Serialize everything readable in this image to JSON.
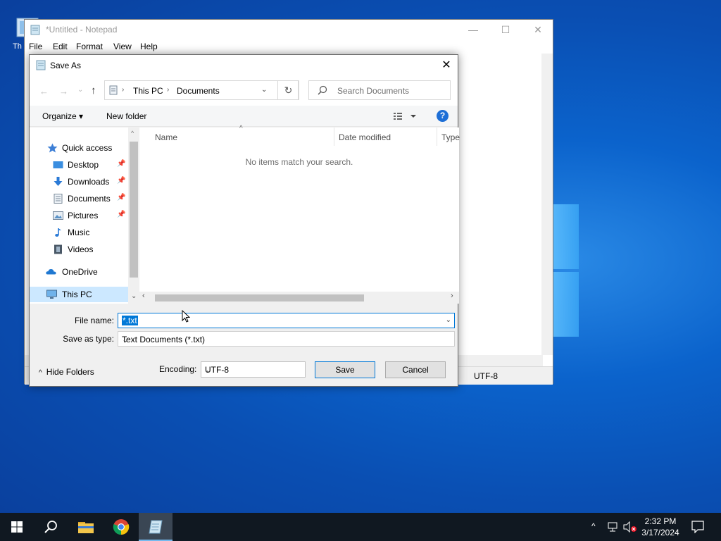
{
  "desktop": {
    "icon_label": "Th"
  },
  "notepad": {
    "title": "*Untitled - Notepad",
    "menu": [
      "File",
      "Edit",
      "Format",
      "View",
      "Help"
    ],
    "status_encoding": "UTF-8",
    "minimize": "—",
    "maximize": "☐",
    "close": "✕"
  },
  "dialog": {
    "title": "Save As",
    "close": "✕",
    "nav": {
      "back": "←",
      "forward": "→",
      "recent": "⌄",
      "up": "↑"
    },
    "breadcrumb": [
      "This PC",
      "Documents"
    ],
    "search_placeholder": "Search Documents",
    "toolbar": {
      "organize": "Organize ▾",
      "new_folder": "New folder",
      "help": "?"
    },
    "nav_items": [
      {
        "label": "Quick access",
        "icon": "star-icon"
      },
      {
        "label": "Desktop",
        "icon": "desktop-folder-icon",
        "pinned": true
      },
      {
        "label": "Downloads",
        "icon": "download-arrow-icon",
        "pinned": true
      },
      {
        "label": "Documents",
        "icon": "documents-icon",
        "pinned": true
      },
      {
        "label": "Pictures",
        "icon": "pictures-icon",
        "pinned": true
      },
      {
        "label": "Music",
        "icon": "music-note-icon"
      },
      {
        "label": "Videos",
        "icon": "film-icon"
      },
      {
        "label": "OneDrive",
        "icon": "cloud-icon"
      },
      {
        "label": "This PC",
        "icon": "computer-icon",
        "selected": true
      }
    ],
    "columns": [
      "Name",
      "Date modified",
      "Type"
    ],
    "empty_message": "No items match your search.",
    "file_name_label": "File name:",
    "file_name_value": "*.txt",
    "save_as_type_label": "Save as type:",
    "save_as_type_value": "Text Documents (*.txt)",
    "hide_folders": "Hide Folders",
    "encoding_label": "Encoding:",
    "encoding_value": "UTF-8",
    "save": "Save",
    "cancel": "Cancel"
  },
  "taskbar": {
    "time": "2:32 PM",
    "date": "3/17/2024",
    "apps": [
      "start-icon",
      "search-icon",
      "file-explorer-icon",
      "chrome-icon",
      "notepad-icon"
    ]
  },
  "colors": {
    "accent": "#0078d7",
    "taskbar": "#101821",
    "desktop": "#0a4fb3"
  }
}
